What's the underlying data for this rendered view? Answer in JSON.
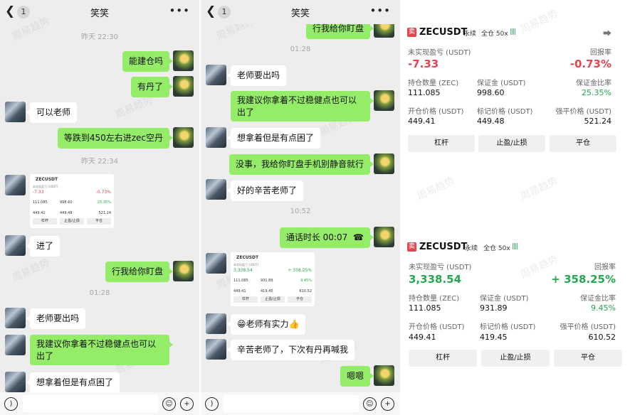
{
  "chat1": {
    "title": "笑笑",
    "badge": "1",
    "times": [
      "昨天 22:30",
      "昨天 22:34",
      "01:28"
    ],
    "messages": {
      "m1": "能建仓吗",
      "m2": "有丹了",
      "m3": "可以老师",
      "m4": "等跌到450左右进zec空丹",
      "m5": "进了",
      "m6": "行我给你盯盘",
      "m7": "老师要出吗",
      "m8": "我建议你拿着不过稳健点也可以出了",
      "m9": "想拿着但是有点困了"
    }
  },
  "chat2": {
    "title": "笑笑",
    "badge": "1",
    "times": [
      "01:28",
      "10:52"
    ],
    "messages": {
      "m0": "行我给你盯盘",
      "m1": "老师要出吗",
      "m2": "我建议你拿着不过稳健点也可以出了",
      "m3": "想拿着但是有点困了",
      "m4": "没事，我给你盯盘手机别静音就行",
      "m5": "好的辛苦老师了",
      "m6": "通话时长 00:07",
      "m7": "😁老师有实力👍",
      "m8": "辛苦老师了，下次有丹再喊我",
      "m9": "嗯嗯"
    }
  },
  "watermark": "周易趋势",
  "positions": [
    {
      "side": "卖",
      "symbol": "ZECUSDT",
      "type": "永续",
      "mode": "全仓 50x",
      "bars": "||||",
      "pnl_label": "未实现盈亏 (USDT)",
      "pnl": "-7.33",
      "roe_label": "回报率",
      "roe": "-0.73%",
      "qty_label": "持仓数量 (ZEC)",
      "qty": "111.085",
      "margin_label": "保证金 (USDT)",
      "margin": "998.60",
      "margin_ratio_label": "保证金比率",
      "margin_ratio": "25.35%",
      "entry_label": "开仓价格 (USDT)",
      "entry": "449.41",
      "mark_label": "标记价格 (USDT)",
      "mark": "449.48",
      "liq_label": "强平价格 (USDT)",
      "liq": "521.24",
      "btn_leverage": "杠杆",
      "btn_tpsl": "止盈/止损",
      "btn_close": "平仓"
    },
    {
      "side": "卖",
      "symbol": "ZECUSDT",
      "type": "永续",
      "mode": "全仓 50x",
      "bars": "||||",
      "pnl_label": "未实现盈亏 (USDT)",
      "pnl": "3,338.54",
      "roe_label": "回报率",
      "roe": "+ 358.25%",
      "qty_label": "持仓数量 (ZEC)",
      "qty": "111.085",
      "margin_label": "保证金 (USDT)",
      "margin": "931.89",
      "margin_ratio_label": "保证金比率",
      "margin_ratio": "9.45%",
      "entry_label": "开仓价格 (USDT)",
      "entry": "449.41",
      "mark_label": "标记价格 (USDT)",
      "mark": "419.45",
      "liq_label": "强平价格 (USDT)",
      "liq": "610.52",
      "btn_leverage": "杠杆",
      "btn_tpsl": "止盈/止损",
      "btn_close": "平仓"
    }
  ],
  "icons": {
    "back": "chevron-left-icon",
    "more": "more-dots-icon",
    "voice": "voice-icon",
    "emoji": "emoji-icon",
    "plus": "plus-icon",
    "share": "share-icon",
    "phone": "phone-icon"
  },
  "colors": {
    "bubble_me": "#95ec69",
    "loss": "#e0464e",
    "gain": "#25a750"
  }
}
